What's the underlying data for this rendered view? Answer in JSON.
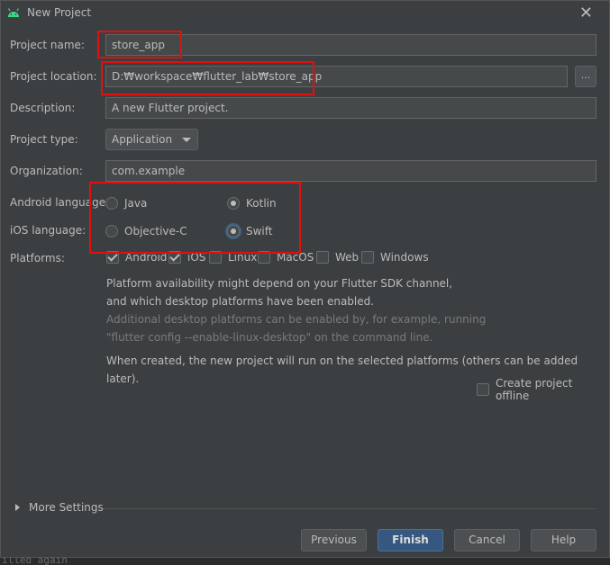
{
  "window": {
    "title": "New Project"
  },
  "form": {
    "project_name_label": "Project name:",
    "project_name_value": "store_app",
    "project_location_label": "Project location:",
    "project_location_value": "D:₩workspace₩flutter_lab₩store_app",
    "browse_label": "...",
    "description_label": "Description:",
    "description_value": "A new Flutter project.",
    "project_type_label": "Project type:",
    "project_type_value": "Application",
    "organization_label": "Organization:",
    "organization_value": "com.example",
    "android_language_label": "Android language:",
    "android_options": [
      {
        "label": "Java",
        "selected": false
      },
      {
        "label": "Kotlin",
        "selected": true
      }
    ],
    "ios_language_label": "iOS language:",
    "ios_options": [
      {
        "label": "Objective-C",
        "selected": false
      },
      {
        "label": "Swift",
        "selected": true
      }
    ],
    "platforms_label": "Platforms:",
    "platforms": [
      {
        "label": "Android",
        "checked": true
      },
      {
        "label": "iOS",
        "checked": true
      },
      {
        "label": "Linux",
        "checked": false
      },
      {
        "label": "MacOS",
        "checked": false
      },
      {
        "label": "Web",
        "checked": false
      },
      {
        "label": "Windows",
        "checked": false
      }
    ],
    "info_line1": "Platform availability might depend on your Flutter SDK channel,",
    "info_line2": "and which desktop platforms have been enabled.",
    "hint_line1": "Additional desktop platforms can be enabled by, for example, running",
    "hint_line2": "\"flutter config --enable-linux-desktop\" on the command line.",
    "created_note": "When created, the new project will run on the selected platforms (others can be added later).",
    "offline_label": "Create project offline",
    "offline_checked": false,
    "more_settings_label": "More Settings"
  },
  "buttons": {
    "previous": "Previous",
    "finish": "Finish",
    "cancel": "Cancel",
    "help": "Help"
  },
  "background_text": "illed again",
  "colors": {
    "annotation_red": "#e01010",
    "primary_button": "#365880",
    "android_green": "#3ddc84"
  },
  "icons": {
    "app_icon": "android-icon",
    "close": "close-icon"
  }
}
